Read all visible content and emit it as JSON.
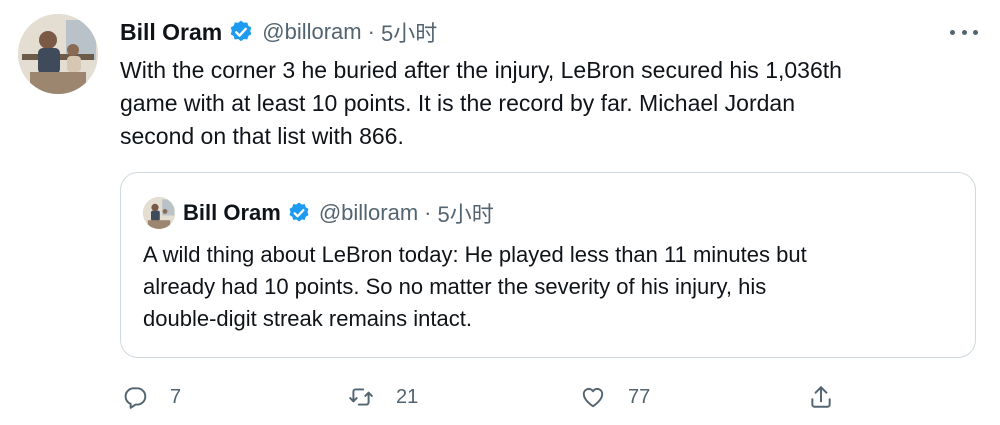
{
  "tweet": {
    "author": {
      "name": "Bill Oram",
      "handle": "@billoram",
      "separator": "·",
      "time": "5小时"
    },
    "text": "With the corner 3 he buried after the injury, LeBron secured his 1,036th\ngame with at least 10 points. It is the record by far. Michael Jordan\nsecond on that list with 866.",
    "quoted": {
      "author": {
        "name": "Bill Oram",
        "handle": "@billoram",
        "separator": "·",
        "time": "5小时"
      },
      "text": "A wild thing about LeBron today: He played less than 11 minutes but\nalready had 10 points. So no matter the severity of his injury, his\ndouble-digit streak remains intact."
    },
    "actions": {
      "reply_count": "7",
      "retweet_count": "21",
      "like_count": "77"
    }
  },
  "icons": [
    "verified-icon",
    "more-icon",
    "reply-icon",
    "retweet-icon",
    "like-icon",
    "share-icon"
  ],
  "colors": {
    "verified": "#1d9bf0",
    "secondary_text": "#536471",
    "border": "#cfd9de",
    "text": "#0f1419"
  }
}
